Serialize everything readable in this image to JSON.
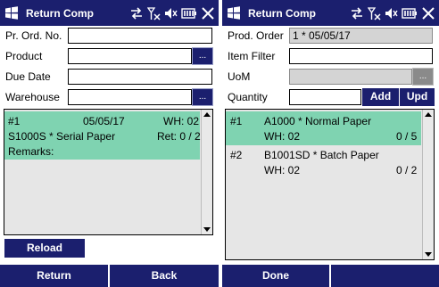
{
  "colors": {
    "titlebar": "#1b1f6e",
    "selected_row": "#7fd3b1",
    "list_bg": "#e6e6e6"
  },
  "left": {
    "title": "Return Comp",
    "status_icons": [
      "sync-icon",
      "no-signal-icon",
      "volume-muted-icon",
      "battery-icon",
      "close-icon"
    ],
    "fields": {
      "pr_ord_no": {
        "label": "Pr. Ord. No.",
        "value": ""
      },
      "product": {
        "label": "Product",
        "value": ""
      },
      "due_date": {
        "label": "Due Date",
        "value": ""
      },
      "warehouse": {
        "label": "Warehouse",
        "value": ""
      }
    },
    "lookup_label": "...",
    "items": [
      {
        "index": "#1",
        "date": "05/05/17",
        "wh": "WH: 02",
        "product": "S1000S * Serial Paper",
        "ret": "Ret: 0 / 2",
        "remarks": "Remarks:"
      }
    ],
    "reload_label": "Reload",
    "softkeys": {
      "left": "Return",
      "right": "Back"
    }
  },
  "right": {
    "title": "Return Comp",
    "status_icons": [
      "sync-icon",
      "no-signal-icon",
      "volume-muted-icon",
      "battery-icon",
      "close-icon"
    ],
    "fields": {
      "prod_order": {
        "label": "Prod. Order",
        "value": "1 * 05/05/17"
      },
      "item_filter": {
        "label": "Item Filter",
        "value": ""
      },
      "uom": {
        "label": "UoM",
        "value": ""
      },
      "quantity": {
        "label": "Quantity",
        "value": ""
      }
    },
    "lookup_label": "...",
    "add_label": "Add",
    "upd_label": "Upd",
    "items": [
      {
        "index": "#1",
        "product": "A1000 * Normal Paper",
        "wh": "WH: 02",
        "qty": "0 / 5"
      },
      {
        "index": "#2",
        "product": "B1001SD * Batch Paper",
        "wh": "WH: 02",
        "qty": "0 / 2"
      }
    ],
    "softkeys": {
      "left": "Done",
      "right": ""
    }
  }
}
